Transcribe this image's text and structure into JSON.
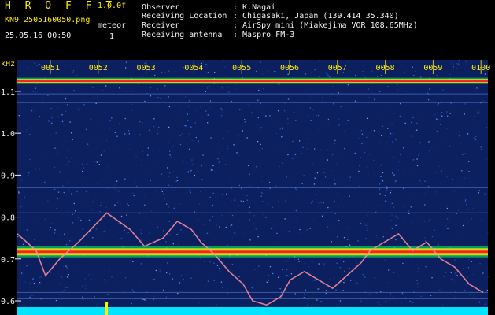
{
  "app": {
    "name": "H R O F F T",
    "version": "1.0.0f",
    "file": "KN9_2505160050.png",
    "timestamp": "25.05.16 00:50",
    "meteor_label": "meteor",
    "meteor_count": "1"
  },
  "meta": [
    {
      "key": "Observer",
      "value": ": K.Nagai"
    },
    {
      "key": "Receiving Location",
      "value": ": Chigasaki, Japan (139.414 35.340)"
    },
    {
      "key": "Receiver",
      "value": ": AirSpy mini (Miakejima VOR 108.65MHz)"
    },
    {
      "key": "Receiving antenna",
      "value": ": Maspro FM-3"
    }
  ],
  "spectrogram": {
    "unit": "kHz",
    "time_labels": [
      "0051",
      "0052",
      "0053",
      "0054",
      "0055",
      "0056",
      "0057",
      "0058",
      "0059",
      "0100"
    ],
    "freq_labels": [
      "1.1",
      "1.0",
      "0.9",
      "0.8",
      "0.7",
      "0.6"
    ],
    "freq_range": [
      0.585,
      1.175
    ],
    "carriers_khz": [
      1.125,
      0.717
    ],
    "faint_lines_khz": [
      1.094,
      1.073,
      0.81,
      0.87,
      0.62,
      0.605
    ],
    "traces_khz": [
      [
        [
          0.0,
          0.76
        ],
        [
          0.04,
          0.72
        ],
        [
          0.06,
          0.66
        ],
        [
          0.09,
          0.7
        ],
        [
          0.13,
          0.74
        ],
        [
          0.19,
          0.81
        ],
        [
          0.24,
          0.77
        ],
        [
          0.27,
          0.73
        ],
        [
          0.31,
          0.75
        ],
        [
          0.34,
          0.79
        ],
        [
          0.37,
          0.77
        ],
        [
          0.39,
          0.74
        ],
        [
          0.42,
          0.71
        ],
        [
          0.45,
          0.67
        ],
        [
          0.48,
          0.64
        ],
        [
          0.5,
          0.6
        ],
        [
          0.53,
          0.59
        ],
        [
          0.56,
          0.61
        ],
        [
          0.58,
          0.65
        ],
        [
          0.61,
          0.67
        ],
        [
          0.64,
          0.65
        ],
        [
          0.67,
          0.63
        ],
        [
          0.7,
          0.66
        ],
        [
          0.73,
          0.69
        ],
        [
          0.75,
          0.72
        ],
        [
          0.78,
          0.74
        ],
        [
          0.81,
          0.76
        ],
        [
          0.84,
          0.72
        ],
        [
          0.87,
          0.74
        ],
        [
          0.9,
          0.7
        ],
        [
          0.93,
          0.68
        ],
        [
          0.96,
          0.64
        ],
        [
          0.99,
          0.62
        ]
      ]
    ],
    "colors": {
      "carrier_core": "#ff2020",
      "carrier_mid": "#ffee00",
      "carrier_edge": "#00ff66",
      "noise": "#123a9c",
      "trace": "#ff8fa0",
      "signal_strip": "#00e5ff",
      "marker": "#ffee00"
    }
  }
}
